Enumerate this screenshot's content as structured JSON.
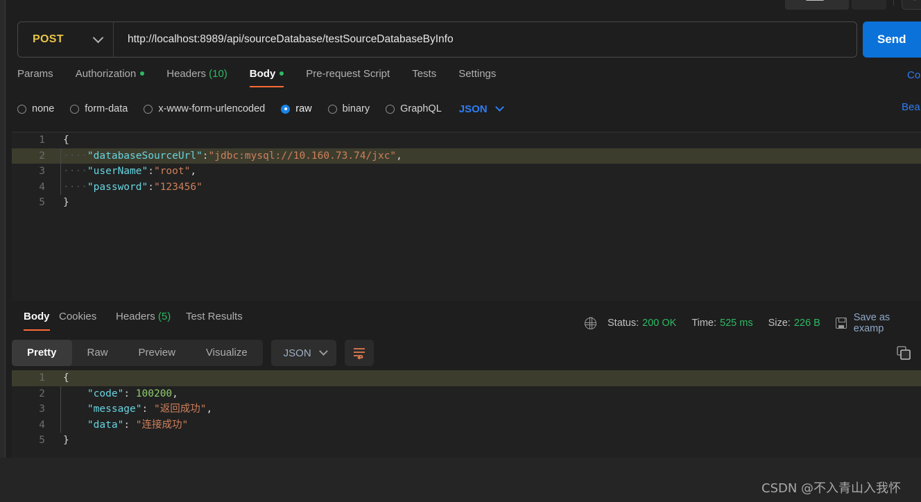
{
  "request": {
    "method": "POST",
    "url": "http://localhost:8989/api/sourceDatabase/testSourceDatabaseByInfo",
    "send_label": "Send",
    "tabs": [
      {
        "label": "Params",
        "active": false,
        "dot": false,
        "count": null
      },
      {
        "label": "Authorization",
        "active": false,
        "dot": true,
        "count": null
      },
      {
        "label": "Headers",
        "active": false,
        "dot": false,
        "count": "(10)"
      },
      {
        "label": "Body",
        "active": true,
        "dot": true,
        "count": null
      },
      {
        "label": "Pre-request Script",
        "active": false,
        "dot": false,
        "count": null
      },
      {
        "label": "Tests",
        "active": false,
        "dot": false,
        "count": null
      },
      {
        "label": "Settings",
        "active": false,
        "dot": false,
        "count": null
      }
    ],
    "cookies_link": "Co",
    "beautify_link": "Bea",
    "body_types": [
      {
        "label": "none",
        "selected": false
      },
      {
        "label": "form-data",
        "selected": false
      },
      {
        "label": "x-www-form-urlencoded",
        "selected": false
      },
      {
        "label": "raw",
        "selected": true
      },
      {
        "label": "binary",
        "selected": false
      },
      {
        "label": "GraphQL",
        "selected": false
      }
    ],
    "format": "JSON",
    "body_lines": [
      {
        "num": "1",
        "highlight": false,
        "indent": false,
        "tokens": [
          {
            "t": "pun",
            "v": "{"
          }
        ]
      },
      {
        "num": "2",
        "highlight": true,
        "indent": true,
        "tokens": [
          {
            "t": "ws",
            "v": "····"
          },
          {
            "t": "key",
            "v": "\"databaseSourceUrl\""
          },
          {
            "t": "pun",
            "v": ":"
          },
          {
            "t": "str",
            "v": "\"jdbc:mysql://10.160.73.74/jxc\""
          },
          {
            "t": "pun",
            "v": ","
          }
        ]
      },
      {
        "num": "3",
        "highlight": false,
        "indent": true,
        "tokens": [
          {
            "t": "ws",
            "v": "····"
          },
          {
            "t": "key",
            "v": "\"userName\""
          },
          {
            "t": "pun",
            "v": ":"
          },
          {
            "t": "str",
            "v": "\"root\""
          },
          {
            "t": "pun",
            "v": ","
          }
        ]
      },
      {
        "num": "4",
        "highlight": false,
        "indent": true,
        "tokens": [
          {
            "t": "ws",
            "v": "····"
          },
          {
            "t": "key",
            "v": "\"password\""
          },
          {
            "t": "pun",
            "v": ":"
          },
          {
            "t": "str",
            "v": "\"123456\""
          }
        ]
      },
      {
        "num": "5",
        "highlight": false,
        "indent": false,
        "tokens": [
          {
            "t": "pun",
            "v": "}"
          }
        ]
      }
    ]
  },
  "response": {
    "tabs": [
      {
        "label": "Body",
        "active": true,
        "count": null
      },
      {
        "label": "Cookies",
        "active": false,
        "count": null
      },
      {
        "label": "Headers",
        "active": false,
        "count": "(5)"
      },
      {
        "label": "Test Results",
        "active": false,
        "count": null
      }
    ],
    "status_label": "Status:",
    "status_value": "200 OK",
    "time_label": "Time:",
    "time_value": "525 ms",
    "size_label": "Size:",
    "size_value": "226 B",
    "save_example": "Save as examp",
    "view_modes": [
      {
        "label": "Pretty",
        "active": true
      },
      {
        "label": "Raw",
        "active": false
      },
      {
        "label": "Preview",
        "active": false
      },
      {
        "label": "Visualize",
        "active": false
      }
    ],
    "format": "JSON",
    "body_lines": [
      {
        "num": "1",
        "highlight": true,
        "indent": false,
        "tokens": [
          {
            "t": "pun",
            "v": "{"
          }
        ]
      },
      {
        "num": "2",
        "highlight": false,
        "indent": true,
        "tokens": [
          {
            "t": "pun",
            "v": "    "
          },
          {
            "t": "key",
            "v": "\"code\""
          },
          {
            "t": "pun",
            "v": ": "
          },
          {
            "t": "num",
            "v": "100200"
          },
          {
            "t": "pun",
            "v": ","
          }
        ]
      },
      {
        "num": "3",
        "highlight": false,
        "indent": true,
        "tokens": [
          {
            "t": "pun",
            "v": "    "
          },
          {
            "t": "key",
            "v": "\"message\""
          },
          {
            "t": "pun",
            "v": ": "
          },
          {
            "t": "str",
            "v": "\"返回成功\""
          },
          {
            "t": "pun",
            "v": ","
          }
        ]
      },
      {
        "num": "4",
        "highlight": false,
        "indent": true,
        "tokens": [
          {
            "t": "pun",
            "v": "    "
          },
          {
            "t": "key",
            "v": "\"data\""
          },
          {
            "t": "pun",
            "v": ": "
          },
          {
            "t": "str",
            "v": "\"连接成功\""
          }
        ]
      },
      {
        "num": "5",
        "highlight": false,
        "indent": false,
        "tokens": [
          {
            "t": "pun",
            "v": "}"
          }
        ]
      }
    ]
  },
  "watermark": "CSDN @不入青山入我怀",
  "colors": {
    "accent": "#ff6c37",
    "send": "#0b72d9",
    "success": "#2dba63",
    "method": "#e8c547",
    "link": "#2f7ef6"
  }
}
